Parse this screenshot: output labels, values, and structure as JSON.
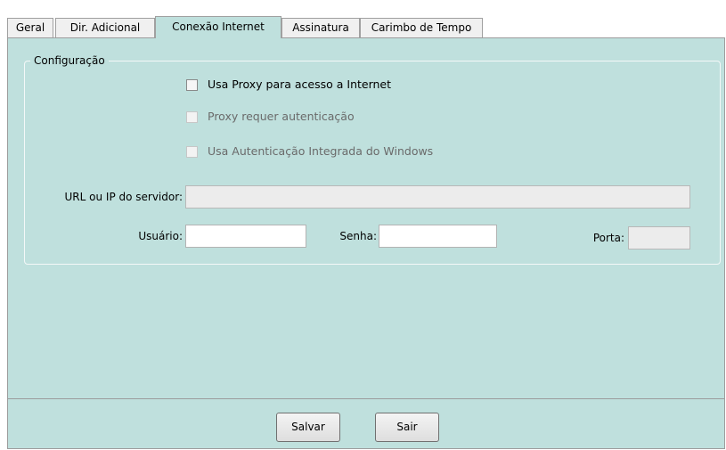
{
  "tabs": [
    {
      "label": "Geral",
      "active": false
    },
    {
      "label": "Dir. Adicional",
      "active": false
    },
    {
      "label": "Conexão Internet",
      "active": true
    },
    {
      "label": "Assinatura",
      "active": false
    },
    {
      "label": "Carimbo de Tempo",
      "active": false
    }
  ],
  "config": {
    "group_title": "Configuração",
    "use_proxy": {
      "label": "Usa Proxy para acesso a Internet",
      "checked": false,
      "enabled": true
    },
    "proxy_auth": {
      "label": "Proxy requer autenticação",
      "checked": false,
      "enabled": false
    },
    "windows_auth": {
      "label": "Usa Autenticação Integrada do Windows",
      "checked": false,
      "enabled": false
    },
    "server": {
      "label": "URL ou IP do servidor:",
      "value": ""
    },
    "user": {
      "label": "Usuário:",
      "value": ""
    },
    "password": {
      "label": "Senha:",
      "value": ""
    },
    "port": {
      "label": "Porta:",
      "value": ""
    }
  },
  "buttons": {
    "save": "Salvar",
    "exit": "Sair"
  },
  "colors": {
    "panel_bg": "#bfe0dd",
    "tab_bg": "#f0f0f0",
    "border": "#9c9c9c"
  }
}
